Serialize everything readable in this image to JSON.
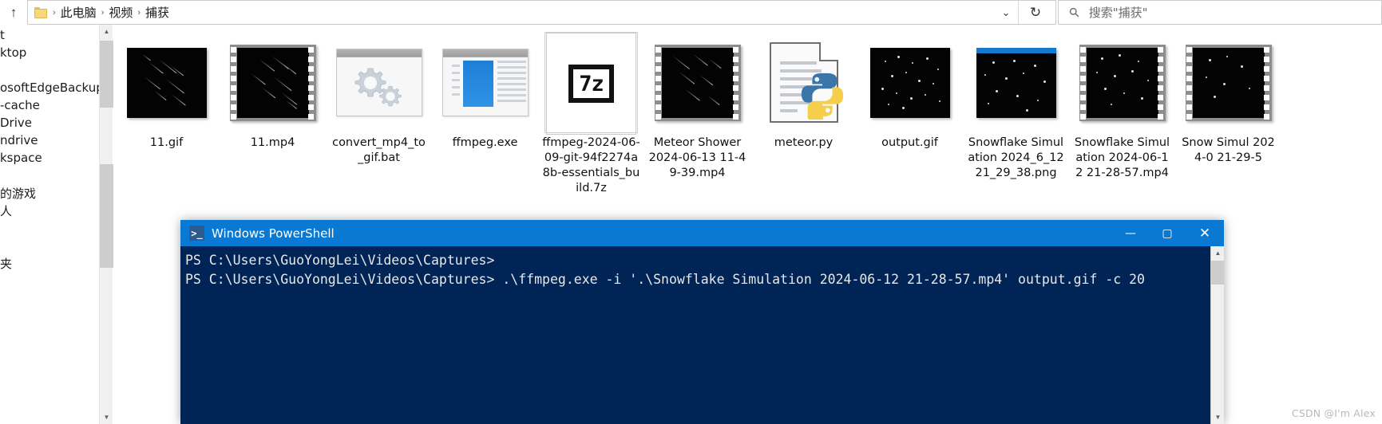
{
  "address_bar": {
    "up_icon": "arrow-up-icon",
    "folder_icon": "folder-icon",
    "breadcrumbs": [
      "此电脑",
      "视频",
      "捕获"
    ],
    "separator": "›",
    "dropdown_icon": "chevron-down-icon",
    "refresh_icon": "refresh-icon",
    "search_icon": "search-icon",
    "search_placeholder": "搜索\"捕获\""
  },
  "nav_pane": {
    "items": [
      {
        "label": "t"
      },
      {
        "label": "ktop"
      },
      {
        "label": ""
      },
      {
        "label": "osoftEdgeBackups"
      },
      {
        "label": "-cache"
      },
      {
        "label": "Drive"
      },
      {
        "label": "ndrive"
      },
      {
        "label": "kspace"
      },
      {
        "label": ""
      },
      {
        "label": "的游戏"
      },
      {
        "label": "人"
      },
      {
        "label": ""
      },
      {
        "label": "夹"
      }
    ]
  },
  "files": [
    {
      "name": "11.gif",
      "icon": "image-thumbnail-meteor",
      "selected": false
    },
    {
      "name": "11.mp4",
      "icon": "video-thumbnail-meteor",
      "selected": false
    },
    {
      "name": "convert_mp4_to_gif.bat",
      "icon": "batch-file-icon",
      "selected": false
    },
    {
      "name": "ffmpeg.exe",
      "icon": "executable-icon",
      "selected": false
    },
    {
      "name": "ffmpeg-2024-06-09-git-94f2274a8b-essentials_build.7z",
      "icon": "sevenzip-archive-icon",
      "selected": true
    },
    {
      "name": "Meteor Shower 2024-06-13 11-49-39.mp4",
      "icon": "video-thumbnail-meteor",
      "selected": false
    },
    {
      "name": "meteor.py",
      "icon": "python-file-icon",
      "selected": false
    },
    {
      "name": "output.gif",
      "icon": "image-thumbnail-snow",
      "selected": false
    },
    {
      "name": "Snowflake Simulation 2024_6_12 21_29_38.png",
      "icon": "image-thumbnail-snow-window",
      "selected": false
    },
    {
      "name": "Snowflake Simulation 2024-06-12 21-28-57.mp4",
      "icon": "video-thumbnail-snow",
      "selected": false
    },
    {
      "name": "Snow Simul 2024-0 21-29-5",
      "icon": "video-thumbnail-snow",
      "selected": false
    }
  ],
  "powershell": {
    "title": "Windows PowerShell",
    "icon": "powershell-icon",
    "minimize_label": "—",
    "maximize_label": "▢",
    "close_label": "✕",
    "lines": [
      "PS C:\\Users\\GuoYongLei\\Videos\\Captures>",
      "PS C:\\Users\\GuoYongLei\\Videos\\Captures> .\\ffmpeg.exe -i '.\\Snowflake Simulation 2024-06-12 21-28-57.mp4' output.gif -c 20"
    ],
    "background_color": "#012456",
    "title_color": "#0a79d4"
  },
  "watermark": "CSDN @I'm Alex"
}
